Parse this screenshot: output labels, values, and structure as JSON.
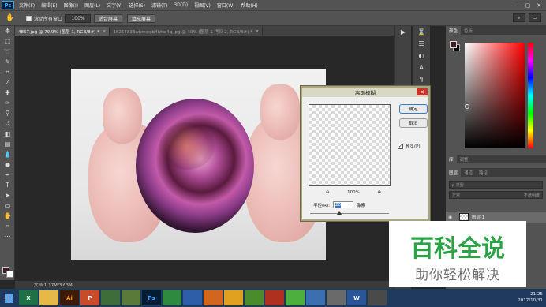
{
  "menubar": {
    "logo": "Ps",
    "items": [
      "文件(F)",
      "编辑(E)",
      "图像(I)",
      "图层(L)",
      "文字(Y)",
      "选择(S)",
      "滤镜(T)",
      "3D(D)",
      "视图(V)",
      "窗口(W)",
      "帮助(H)"
    ],
    "window_controls": [
      "—",
      "▢",
      "✕"
    ]
  },
  "optionsbar": {
    "checkbox_label": "滚动所有窗口",
    "zoom_value": "100%",
    "fit_screen": "适合屏幕",
    "fill_screen": "填充屏幕"
  },
  "tabs": [
    {
      "label": "4867.jpg @ 79.9% (图层 1, RGB/8#) *",
      "active": true
    },
    {
      "label": "1625483​3whmwgb4hhw4q.jpg @ 40% (图层 1 拷贝 2, RGB/8#) *",
      "active": false
    }
  ],
  "tab_close": "×",
  "statusbar": {
    "text": "文档:1.37M/3.63M"
  },
  "color_panel": {
    "tabs": [
      "颜色",
      "色板"
    ]
  },
  "layers_panel": {
    "upper_tabs": [
      "库",
      "调整"
    ],
    "tabs": [
      "图层",
      "通道",
      "路径"
    ],
    "filter_placeholder": "ρ 类型",
    "blend_mode": "正常",
    "opacity_label": "不透明度",
    "layer_name": "图层 1"
  },
  "dialog": {
    "title": "高斯模糊",
    "ok_label": "确定",
    "cancel_label": "取消",
    "preview_label": "预览(P)",
    "preview_checked": "✓",
    "zoom_value": "100%",
    "zoom_out": "⊖",
    "zoom_in": "⊕",
    "radius_label": "半径(R):",
    "radius_value": "20",
    "radius_unit": "像素",
    "close_icon": "✕"
  },
  "watermark": {
    "title": "百科全说",
    "subtitle": "助你轻松解决"
  },
  "taskbar": {
    "apps": [
      "X",
      "",
      "Ai",
      "P",
      "",
      "",
      "Ps",
      "",
      "",
      "",
      "",
      "",
      "",
      "",
      "",
      "",
      "W",
      ""
    ],
    "time": "21:25",
    "date": "2017/10/31"
  },
  "colors": {
    "accent": "#31a8ff",
    "watermark_green": "#2ba245",
    "dialog_frame": "#a9a77e"
  }
}
